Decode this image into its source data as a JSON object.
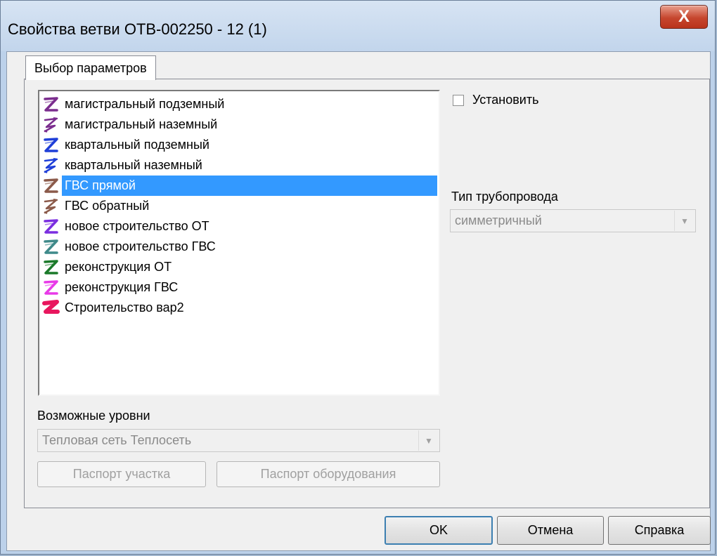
{
  "window": {
    "title": "Свойства ветви  ОТВ-002250 - 12 (1)",
    "close_glyph": "X"
  },
  "tab": {
    "label": "Выбор параметров"
  },
  "list": {
    "items": [
      {
        "label": "магистральный подземный",
        "color": "#7b2d8e",
        "icon": "pipe-underground-icon",
        "selected": false
      },
      {
        "label": "магистральный наземный",
        "color": "#7b2d8e",
        "icon": "pipe-overground-icon",
        "selected": false
      },
      {
        "label": "квартальный подземный",
        "color": "#1f3fd8",
        "icon": "pipe-underground-icon",
        "selected": false
      },
      {
        "label": "квартальный наземный",
        "color": "#1f3fd8",
        "icon": "pipe-overground-icon",
        "selected": false
      },
      {
        "label": "ГВС прямой",
        "color": "#8b5a4a",
        "icon": "pipe-underground-icon",
        "selected": true
      },
      {
        "label": "ГВС обратный",
        "color": "#8b5a4a",
        "icon": "pipe-overground-icon",
        "selected": false
      },
      {
        "label": "новое строительство ОТ",
        "color": "#7b2fe0",
        "icon": "pipe-underground-icon",
        "selected": false
      },
      {
        "label": "новое строительство ГВС",
        "color": "#3f8a8a",
        "icon": "pipe-underground-icon",
        "selected": false
      },
      {
        "label": "реконструкция ОТ",
        "color": "#1b7a2a",
        "icon": "pipe-underground-icon",
        "selected": false
      },
      {
        "label": "реконструкция ГВС",
        "color": "#e83ae8",
        "icon": "pipe-underground-icon",
        "selected": false
      },
      {
        "label": "Строительство вар2",
        "color": "#e8175e",
        "icon": "pipe-thick-icon",
        "selected": false
      }
    ]
  },
  "checkbox": {
    "label": "Установить",
    "checked": false
  },
  "pipe_type": {
    "label": "Тип трубопровода",
    "value": "симметричный"
  },
  "levels": {
    "label": "Возможные уровни",
    "value": "Тепловая сеть Теплосеть"
  },
  "buttons": {
    "passport_section": "Паспорт участка",
    "passport_equipment": "Паспорт оборудования",
    "ok": "OK",
    "cancel": "Отмена",
    "help": "Справка"
  }
}
